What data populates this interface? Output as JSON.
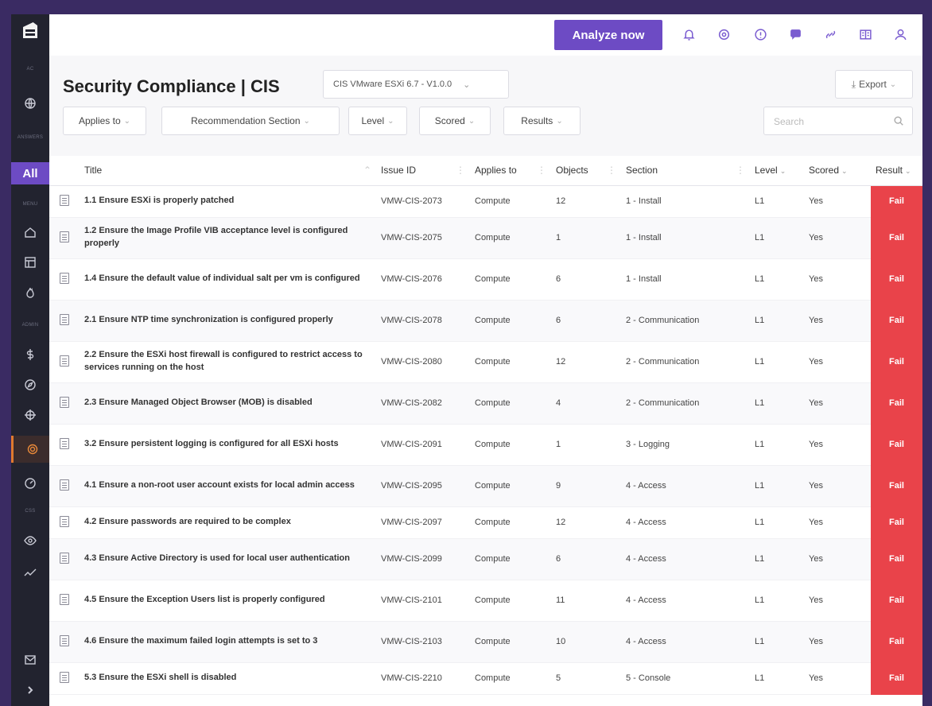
{
  "sidebar": {
    "labels": [
      "AC",
      "ANSWERS",
      "MENU",
      "ADMIN",
      "CSS"
    ],
    "all_label": "All",
    "icons": [
      "logo-icon",
      "globe-icon",
      "home-icon",
      "dashboard-icon",
      "fire-icon",
      "dollar-icon",
      "compass-icon",
      "crosshair-icon",
      "shield-icon",
      "gauge-icon",
      "eye-icon",
      "trend-icon",
      "mail-icon",
      "chevron-right-icon"
    ]
  },
  "topbar": {
    "analyze_label": "Analyze now",
    "icons": [
      "bell-icon",
      "settings-icon",
      "help-icon",
      "chat-icon",
      "link-icon",
      "book-icon",
      "user-icon"
    ]
  },
  "header": {
    "title": "Security Compliance | CIS",
    "benchmark": "CIS VMware ESXi 6.7 - V1.0.0",
    "export_label": "Export",
    "filters": [
      "Applies to",
      "Recommendation Section",
      "Level",
      "Scored",
      "Results"
    ],
    "search_placeholder": "Search"
  },
  "table": {
    "columns": [
      "Title",
      "Issue ID",
      "Applies to",
      "Objects",
      "Section",
      "Level",
      "Scored",
      "Result"
    ],
    "rows": [
      {
        "title": "1.1 Ensure ESXi is properly patched",
        "issue_id": "VMW-CIS-2073",
        "applies_to": "Compute",
        "objects": "12",
        "section": "1 - Install",
        "level": "L1",
        "scored": "Yes",
        "result": "Fail"
      },
      {
        "title": "1.2 Ensure the Image Profile VIB acceptance level is configured properly",
        "issue_id": "VMW-CIS-2075",
        "applies_to": "Compute",
        "objects": "1",
        "section": "1 - Install",
        "level": "L1",
        "scored": "Yes",
        "result": "Fail"
      },
      {
        "title": "1.4 Ensure the default value of individual salt per vm is configured",
        "issue_id": "VMW-CIS-2076",
        "applies_to": "Compute",
        "objects": "6",
        "section": "1 - Install",
        "level": "L1",
        "scored": "Yes",
        "result": "Fail"
      },
      {
        "title": "2.1 Ensure NTP time synchronization is configured properly",
        "issue_id": "VMW-CIS-2078",
        "applies_to": "Compute",
        "objects": "6",
        "section": "2 - Communication",
        "level": "L1",
        "scored": "Yes",
        "result": "Fail"
      },
      {
        "title": "2.2 Ensure the ESXi host firewall is configured to restrict access to services running on the host",
        "issue_id": "VMW-CIS-2080",
        "applies_to": "Compute",
        "objects": "12",
        "section": "2 - Communication",
        "level": "L1",
        "scored": "Yes",
        "result": "Fail"
      },
      {
        "title": "2.3 Ensure Managed Object Browser (MOB) is disabled",
        "issue_id": "VMW-CIS-2082",
        "applies_to": "Compute",
        "objects": "4",
        "section": "2 - Communication",
        "level": "L1",
        "scored": "Yes",
        "result": "Fail"
      },
      {
        "title": "3.2 Ensure persistent logging is configured for all ESXi hosts",
        "issue_id": "VMW-CIS-2091",
        "applies_to": "Compute",
        "objects": "1",
        "section": "3 - Logging",
        "level": "L1",
        "scored": "Yes",
        "result": "Fail"
      },
      {
        "title": "4.1 Ensure a non-root user account exists for local admin access",
        "issue_id": "VMW-CIS-2095",
        "applies_to": "Compute",
        "objects": "9",
        "section": "4 - Access",
        "level": "L1",
        "scored": "Yes",
        "result": "Fail"
      },
      {
        "title": "4.2 Ensure passwords are required to be complex",
        "issue_id": "VMW-CIS-2097",
        "applies_to": "Compute",
        "objects": "12",
        "section": "4 - Access",
        "level": "L1",
        "scored": "Yes",
        "result": "Fail"
      },
      {
        "title": "4.3 Ensure Active Directory is used for local user authentication",
        "issue_id": "VMW-CIS-2099",
        "applies_to": "Compute",
        "objects": "6",
        "section": "4 - Access",
        "level": "L1",
        "scored": "Yes",
        "result": "Fail"
      },
      {
        "title": "4.5 Ensure the Exception Users list is properly configured",
        "issue_id": "VMW-CIS-2101",
        "applies_to": "Compute",
        "objects": "11",
        "section": "4 - Access",
        "level": "L1",
        "scored": "Yes",
        "result": "Fail"
      },
      {
        "title": "4.6 Ensure the maximum failed login attempts is set to 3",
        "issue_id": "VMW-CIS-2103",
        "applies_to": "Compute",
        "objects": "10",
        "section": "4 - Access",
        "level": "L1",
        "scored": "Yes",
        "result": "Fail"
      },
      {
        "title": "5.3 Ensure the ESXi shell is disabled",
        "issue_id": "VMW-CIS-2210",
        "applies_to": "Compute",
        "objects": "5",
        "section": "5 - Console",
        "level": "L1",
        "scored": "Yes",
        "result": "Fail"
      }
    ]
  },
  "colors": {
    "accent": "#6d4bc4",
    "fail": "#e9434a",
    "sidebar": "#22232f",
    "frame": "#3a2b63"
  }
}
